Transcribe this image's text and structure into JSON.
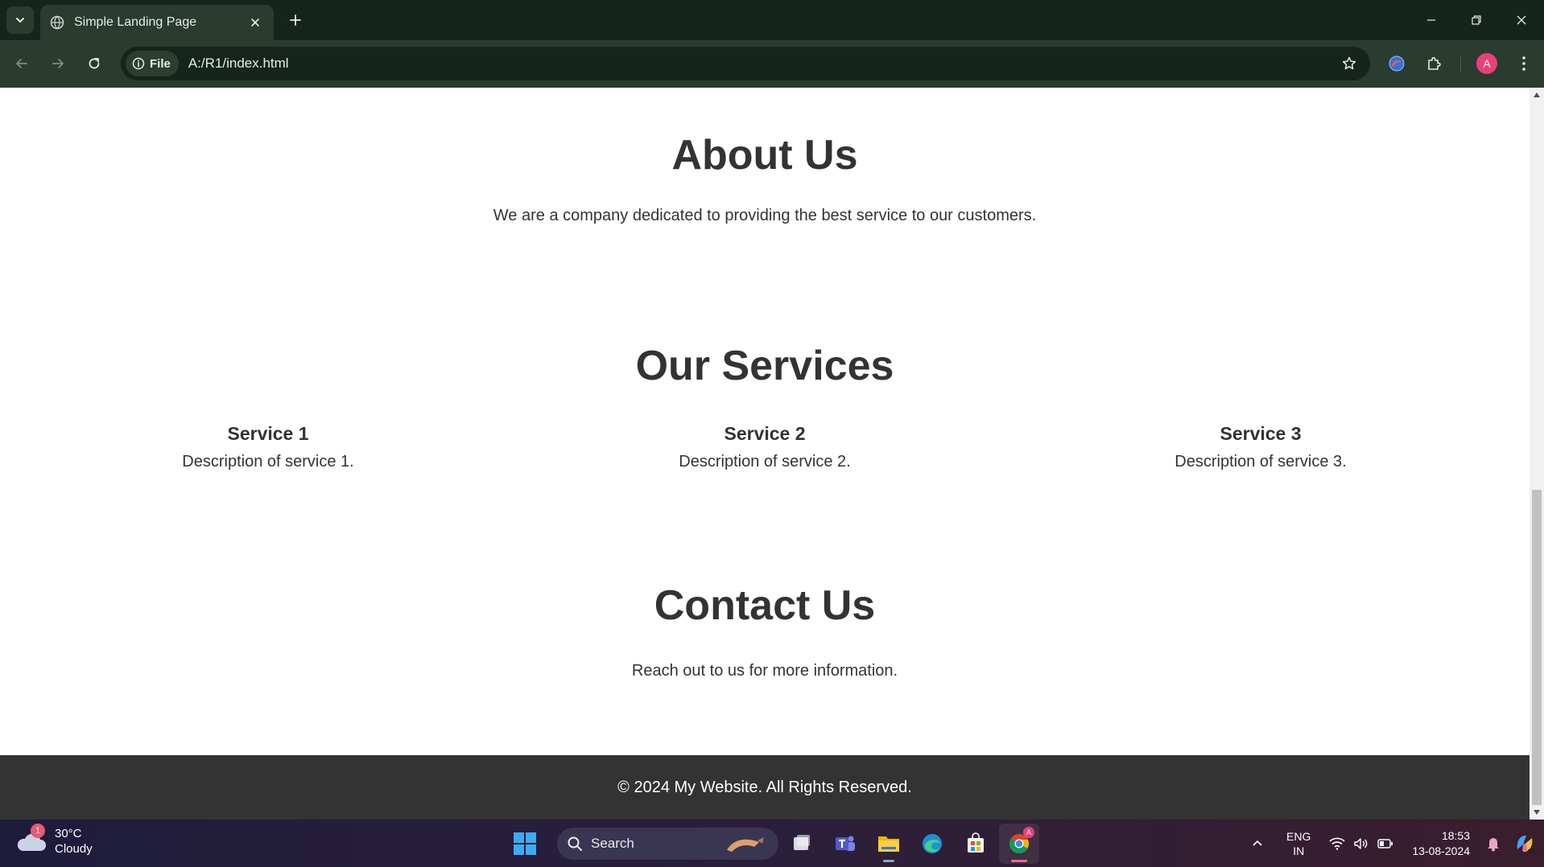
{
  "browser": {
    "tab": {
      "title": "Simple Landing Page"
    },
    "address": {
      "chip_label": "File",
      "url": "A:/R1/index.html"
    },
    "profile_initial": "A"
  },
  "page": {
    "about": {
      "heading": "About Us",
      "text": "We are a company dedicated to providing the best service to our customers."
    },
    "services": {
      "heading": "Our Services",
      "items": [
        {
          "title": "Service 1",
          "description": "Description of service 1."
        },
        {
          "title": "Service 2",
          "description": "Description of service 2."
        },
        {
          "title": "Service 3",
          "description": "Description of service 3."
        }
      ]
    },
    "contact": {
      "heading": "Contact Us",
      "text": "Reach out to us for more information."
    },
    "footer": {
      "text": "© 2024 My Website. All Rights Reserved."
    }
  },
  "taskbar": {
    "weather": {
      "temperature": "30°C",
      "condition": "Cloudy",
      "badge": "1"
    },
    "search_label": "Search",
    "chrome_badge": "A",
    "language": {
      "line1": "ENG",
      "line2": "IN"
    },
    "clock": {
      "time": "18:53",
      "date": "13-08-2024"
    }
  },
  "colors": {
    "text": "#333333",
    "footer_bg": "#333333",
    "chrome_dark": "#16251b",
    "chrome_toolbar": "#2a3b2f",
    "avatar": "#e8407a"
  }
}
